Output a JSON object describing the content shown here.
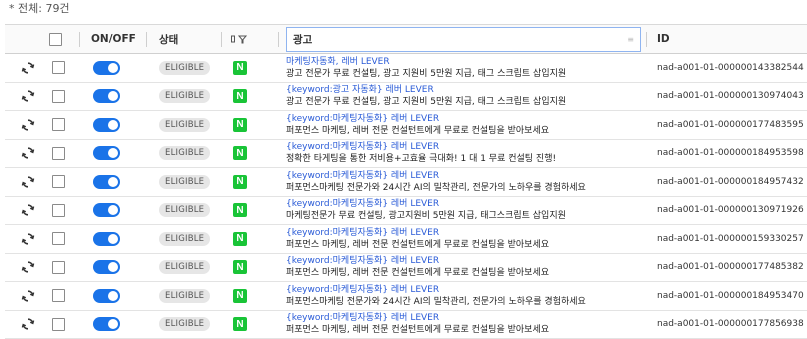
{
  "total_label": "* 전체: 79건",
  "header": {
    "onoff": "ON/OFF",
    "status": "상태",
    "ad": "광고",
    "id": "ID"
  },
  "rows": [
    {
      "status": "ELIGIBLE",
      "title": "마케팅자동화, 레버 LEVER",
      "desc": "광고 전문가 무료 컨설팅, 광고 지원비 5만원 지급, 태그 스크립트 삽입지원",
      "id": "nad-a001-01-000000143382544"
    },
    {
      "status": "ELIGIBLE",
      "title": "{keyword:광고 자동화} 레버 LEVER",
      "desc": "광고 전문가 무료 컨설팅, 광고 지원비 5만원 지급, 태그 스크립트 삽입지원",
      "id": "nad-a001-01-000000130974043"
    },
    {
      "status": "ELIGIBLE",
      "title": "{keyword:마케팅자동화} 레버 LEVER",
      "desc": "퍼포먼스 마케팅, 레버 전문 컨설턴트에게 무료로 컨설팅을 받아보세요",
      "id": "nad-a001-01-000000177483595"
    },
    {
      "status": "ELIGIBLE",
      "title": "{keyword:마케팅자동화} 레버 LEVER",
      "desc": "정확한 타게팅을 통한 저비용+고효율 극대화! 1 대 1 무료 컨설팅 진행!",
      "id": "nad-a001-01-000000184953598"
    },
    {
      "status": "ELIGIBLE",
      "title": "{keyword:마케팅자동화} 레버 LEVER",
      "desc": "퍼포먼스마케팅 전문가와 24시간 AI의 밀착관리, 전문가의 노하우를 경험하세요",
      "id": "nad-a001-01-000000184957432"
    },
    {
      "status": "ELIGIBLE",
      "title": "{keyword:마케팅자동화} 레버 LEVER",
      "desc": "마케팅전문가 무료 컨설팅, 광고지원비 5만원 지급, 태그스크립트 삽입지원",
      "id": "nad-a001-01-000000130971926"
    },
    {
      "status": "ELIGIBLE",
      "title": "{keyword:마케팅자동화} 레버 LEVER",
      "desc": "퍼포먼스 마케팅, 레버 전문 컨설턴트에게 무료로 컨설팅을 받아보세요",
      "id": "nad-a001-01-000000159330257"
    },
    {
      "status": "ELIGIBLE",
      "title": "{keyword:마케팅자동화} 레버 LEVER",
      "desc": "퍼포먼스 마케팅, 레버 전문 컨설턴트에게 무료로 컨설팅을 받아보세요",
      "id": "nad-a001-01-000000177485382"
    },
    {
      "status": "ELIGIBLE",
      "title": "{keyword:마케팅자동화} 레버 LEVER",
      "desc": "퍼포먼스마케팅 전문가와 24시간 AI의 밀착관리, 전문가의 노하우를 경험하세요",
      "id": "nad-a001-01-000000184953470"
    },
    {
      "status": "ELIGIBLE",
      "title": "{keyword:마케팅자동화} 레버 LEVER",
      "desc": "퍼포먼스 마케팅, 레버 전문 컨설턴트에게 무료로 컨설팅을 받아보세요",
      "id": "nad-a001-01-000000177856938"
    }
  ],
  "icons": {
    "sync": "sync-icon",
    "naver": "naver-n-icon",
    "filter": "filter-icon"
  },
  "naver_letter": "N",
  "colors": {
    "toggle_on": "#1a73e8",
    "naver_green": "#19c437",
    "ad_title_link": "#2a5bd7"
  }
}
